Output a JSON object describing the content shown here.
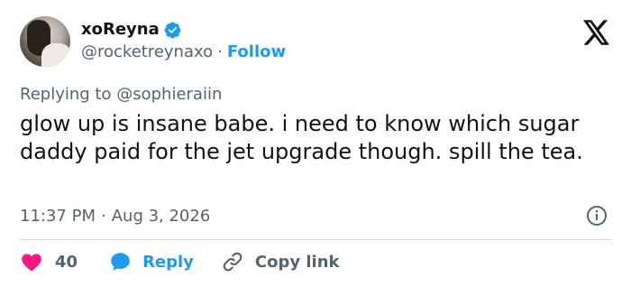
{
  "user": {
    "display_name": "xoReyna",
    "handle": "@rocketreynaxo",
    "separator": "·",
    "follow_label": "Follow"
  },
  "reply": {
    "prefix": "Replying to",
    "mention": "@sophieraiin"
  },
  "tweet": {
    "text": "glow up is insane babe. i need to know which sugar daddy paid for the jet upgrade though. spill the tea.",
    "time": "11:37 PM",
    "separator": "·",
    "date": "Aug 3, 2026"
  },
  "actions": {
    "likes": "40",
    "reply_label": "Reply",
    "copy_label": "Copy link"
  },
  "colors": {
    "accent": "#1d9bf0",
    "like": "#f91880",
    "muted": "#536471",
    "text": "#0f1419",
    "divider": "#cfd9de"
  },
  "icons": [
    "avatar",
    "verified-badge-icon",
    "x-logo-icon",
    "info-icon",
    "heart-icon",
    "reply-bubble-icon",
    "link-icon"
  ]
}
